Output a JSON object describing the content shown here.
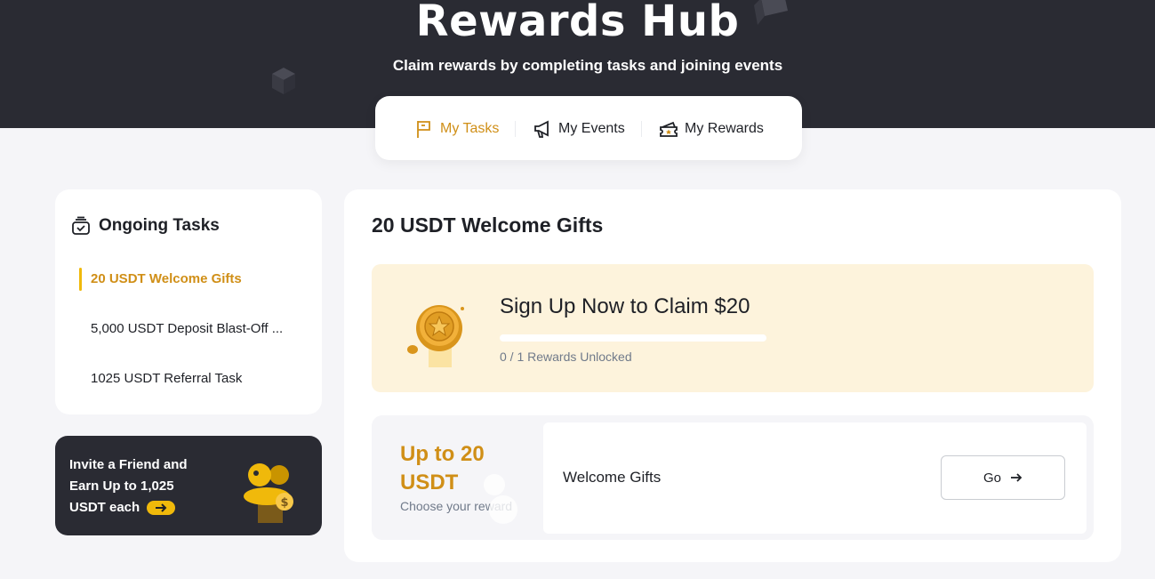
{
  "hero": {
    "title": "Rewards Hub",
    "subtitle": "Claim rewards by completing tasks and joining events"
  },
  "tabs": [
    {
      "label": "My Tasks",
      "icon": "flag-icon",
      "active": true
    },
    {
      "label": "My Events",
      "icon": "megaphone-icon",
      "active": false
    },
    {
      "label": "My Rewards",
      "icon": "ticket-icon",
      "active": false
    }
  ],
  "sidebar": {
    "heading": "Ongoing Tasks",
    "heading_icon": "task-list-icon",
    "items": [
      {
        "label": "20 USDT Welcome Gifts",
        "active": true
      },
      {
        "label": "5,000 USDT Deposit Blast-Off ...",
        "active": false
      },
      {
        "label": "1025 USDT Referral Task",
        "active": false
      }
    ]
  },
  "invite": {
    "text": "Invite a Friend and Earn Up to 1,025 USDT each",
    "illustration": "invite-friends-icon"
  },
  "main": {
    "title": "20 USDT Welcome Gifts",
    "banner": {
      "title": "Sign Up Now to Claim $20",
      "status": "0 / 1 Rewards Unlocked",
      "progress": 0,
      "icon": "gold-coin-icon"
    },
    "reward": {
      "amount": "Up to 20 USDT",
      "hint": "Choose your reward",
      "name": "Welcome Gifts",
      "button_label": "Go"
    }
  },
  "colors": {
    "accent": "#f0b90b",
    "accent_text": "#d08f17",
    "hero_bg": "#2a2b33",
    "page_bg": "#f5f5f8",
    "banner_bg": "#fdf3dc"
  }
}
